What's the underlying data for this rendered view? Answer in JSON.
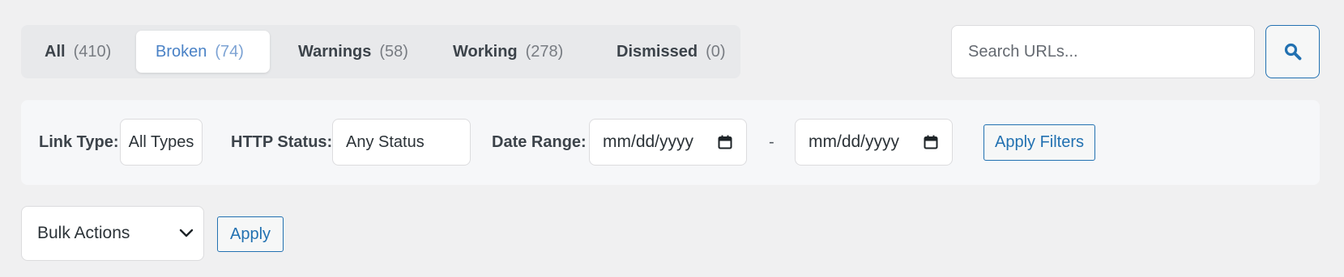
{
  "tabs": [
    {
      "label": "All",
      "count": "(410)",
      "active": false
    },
    {
      "label": "Broken",
      "count": "(74)",
      "active": true
    },
    {
      "label": "Warnings",
      "count": "(58)",
      "active": false
    },
    {
      "label": "Working",
      "count": "(278)",
      "active": false
    },
    {
      "label": "Dismissed",
      "count": "(0)",
      "active": false
    }
  ],
  "search": {
    "placeholder": "Search URLs...",
    "value": "",
    "button_icon": "search-icon"
  },
  "filters": {
    "link_type_label": "Link Type:",
    "link_type_value": "All Types",
    "http_status_label": "HTTP Status:",
    "http_status_value": "Any Status",
    "date_range_label": "Date Range:",
    "date_from": "mm/dd/yyyy",
    "date_separator": "-",
    "date_to": "mm/dd/yyyy",
    "date_icon": "calendar-icon",
    "apply_label": "Apply Filters"
  },
  "bulk": {
    "value": "Bulk Actions",
    "apply_label": "Apply",
    "dropdown_icon": "chevron-down-icon"
  },
  "colors": {
    "page_background": "#f0f0f1",
    "accent": "#2271b1",
    "active_tab_text": "#4a82c6"
  }
}
